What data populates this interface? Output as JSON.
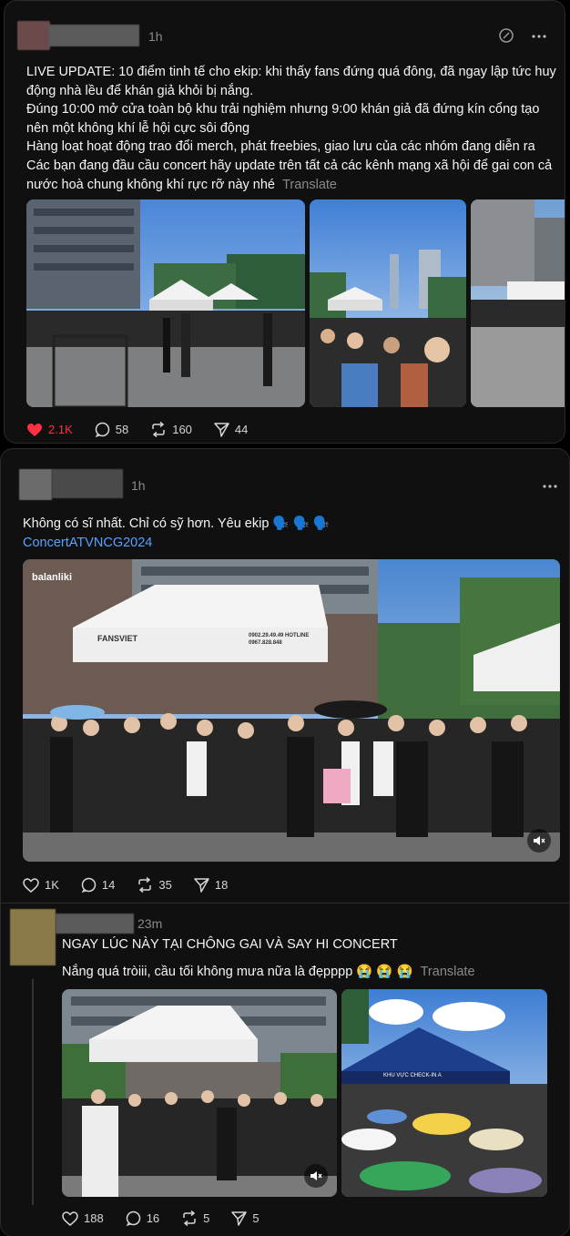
{
  "post1": {
    "time": "1h",
    "lines": [
      "LIVE UPDATE: 10 điểm tinh tế cho ekip: khi thấy fans đứng quá đông, đã ngay lập tức huy",
      "động nhà lều để khán giả khỏi bị nắng.",
      "Đúng 10:00 mở cửa toàn bộ khu trải nghiệm nhưng 9:00 khán giả đã đứng kín cổng tạo",
      "nên một không khí lễ hội cực sôi động",
      "Hàng loạt hoạt động trao đổi merch, phát freebies, giao lưu của các nhóm đang diễn ra",
      "Các bạn đang đầu cầu concert hãy update trên tất cả các kênh mạng xã hội để gai con cả",
      "nước hoà chung không khí rực rỡ này nhé"
    ],
    "translate": "Translate",
    "likes": "2.1K",
    "comments": "58",
    "reposts": "160",
    "shares": "44"
  },
  "post2": {
    "time": "1h",
    "text": "Không có sĩ nhất. Chỉ có sỹ hơn. Yêu ekip 🗣️ 🗣️ 🗣️",
    "hashtag": "ConcertATVNCG2024",
    "watermark": "balanliki",
    "tent_brand": "FANSVIET",
    "hotline": "0902.29.49.49 HOTLINE 0967.828.848",
    "likes": "1K",
    "comments": "14",
    "reposts": "35",
    "shares": "18"
  },
  "post3": {
    "time": "23m",
    "title": "NGAY LÚC NÀY TẠI CHÔNG GAI VÀ SAY HI CONCERT",
    "text": "Nắng quá tròiii, cầu tối không mưa nữa là đẹpppp 😭 😭 😭",
    "translate": "Translate",
    "stage_sign": "KHU VỰC CHECK-IN A",
    "likes": "188",
    "comments": "16",
    "reposts": "5",
    "shares": "5"
  },
  "colors": {
    "accent_red": "#ff3040",
    "muted": "#8a8a8a",
    "link": "#5aa0ff"
  }
}
